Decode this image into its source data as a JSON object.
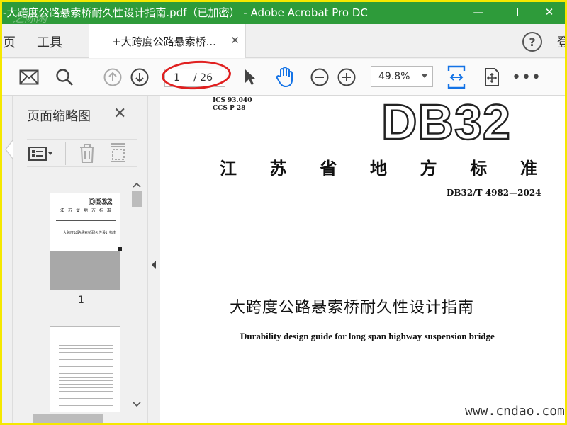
{
  "window": {
    "title": "-大跨度公路悬索桥耐久性设计指南.pdf（已加密） - Adobe Acrobat Pro DC",
    "logo_text": "之际闲"
  },
  "menu": {
    "page_partial": "页",
    "tools": "工具",
    "tab_label": "+大跨度公路悬索桥...",
    "login_partial": "登"
  },
  "toolbar": {
    "page_current": "1",
    "page_total": "/ 26",
    "zoom": "49.8%"
  },
  "panel": {
    "title": "页面缩略图",
    "thumb_label": "1",
    "thumb1_db": "DB32",
    "thumb1_prov": "江苏省地方标准",
    "thumb1_title": "大跨度公路悬索桥耐久性设计指南"
  },
  "document": {
    "ics": "ICS  93.040",
    "ccs": "CCS  P  28",
    "db_code": "DB32",
    "province_chars": [
      "江",
      "苏",
      "省",
      "地",
      "方",
      "标",
      "准"
    ],
    "std_number": "DB32/T 4982—2024",
    "title_cn": "大跨度公路悬索桥耐久性设计指南",
    "title_en": "Durability design guide for long span highway suspension bridge"
  },
  "watermark": "www.cndao.com",
  "colors": {
    "titlebar": "#2e9b3a",
    "frame": "#f5e800",
    "accent_blue": "#1473e6",
    "annotation_red": "#e02020"
  }
}
